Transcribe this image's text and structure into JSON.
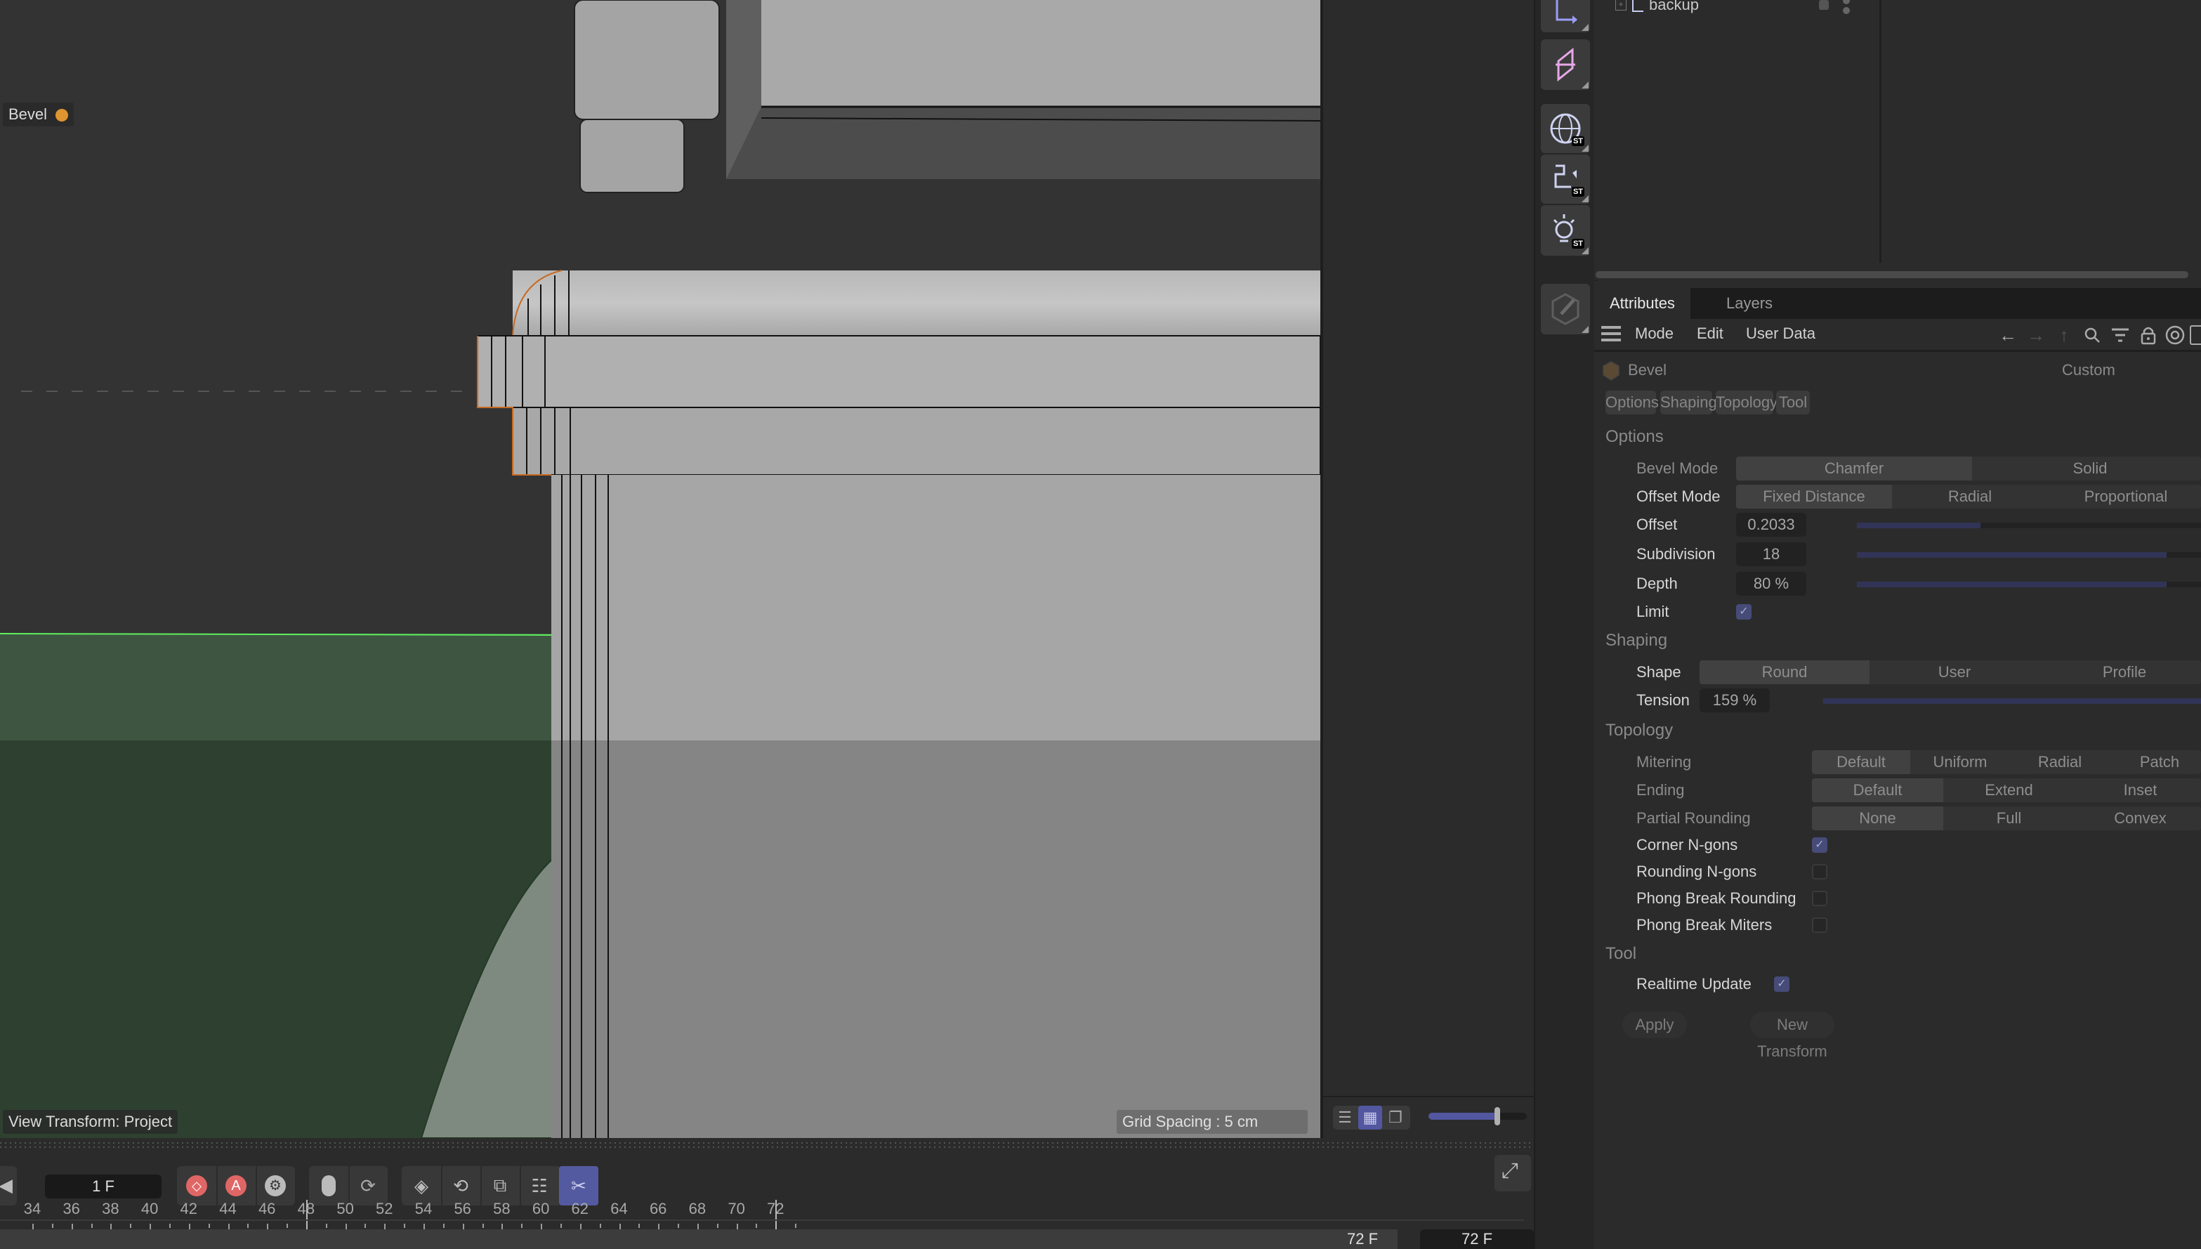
{
  "viewport": {
    "hud_object_label": "Bevel",
    "view_transform_label": "View Transform: Project",
    "grid_spacing_label": "Grid Spacing : 5 cm",
    "view_toggle": {
      "options": [
        "list-view",
        "grid-view",
        "single-view"
      ],
      "selected": "grid-view"
    },
    "zoom_slider_value": 0.7
  },
  "object_manager": {
    "items": [
      {
        "name": "backup",
        "icon": "null-object-icon"
      }
    ]
  },
  "palette": {
    "buttons": [
      "spline-arrow-tool",
      "mirror-tool",
      "sky-st",
      "camera-st",
      "light-st",
      "edit-tool"
    ],
    "badge_text": "ST"
  },
  "attributes": {
    "tabs": [
      {
        "label": "Attributes",
        "active": true
      },
      {
        "label": "Layers",
        "active": false
      }
    ],
    "menu": [
      "Mode",
      "Edit",
      "User Data"
    ],
    "object_name": "Bevel",
    "preset": "Custom",
    "section_tabs": [
      "Options",
      "Shaping",
      "Topology",
      "Tool"
    ],
    "options": {
      "title": "Options",
      "bevel_mode": {
        "label": "Bevel Mode",
        "options": [
          "Chamfer",
          "Solid"
        ],
        "selected": "Chamfer"
      },
      "offset_mode": {
        "label": "Offset Mode",
        "options": [
          "Fixed Distance",
          "Radial",
          "Proportional"
        ],
        "selected": "Fixed Distance"
      },
      "offset": {
        "label": "Offset",
        "value": "0.2033 cm",
        "slider_fraction": 0.36
      },
      "subdivision": {
        "label": "Subdivision",
        "value": "18",
        "slider_fraction": 0.9
      },
      "depth": {
        "label": "Depth",
        "value": "80 %",
        "slider_fraction": 0.9
      },
      "limit": {
        "label": "Limit",
        "checked": true
      }
    },
    "shaping": {
      "title": "Shaping",
      "shape": {
        "label": "Shape",
        "options": [
          "Round",
          "User",
          "Profile"
        ],
        "selected": "Round"
      },
      "tension": {
        "label": "Tension",
        "value": "159 %",
        "slider_fraction": 1.0
      }
    },
    "topology": {
      "title": "Topology",
      "mitering": {
        "label": "Mitering",
        "options": [
          "Default",
          "Uniform",
          "Radial",
          "Patch"
        ],
        "selected": "Default"
      },
      "ending": {
        "label": "Ending",
        "options": [
          "Default",
          "Extend",
          "Inset"
        ],
        "selected": "Default"
      },
      "partial_rounding": {
        "label": "Partial Rounding",
        "options": [
          "None",
          "Full",
          "Convex"
        ],
        "selected": "None"
      },
      "corner_ngons": {
        "label": "Corner N-gons",
        "checked": true
      },
      "rounding_ngons": {
        "label": "Rounding N-gons",
        "checked": false
      },
      "phong_break_rounding": {
        "label": "Phong Break Rounding",
        "checked": false
      },
      "phong_break_miters": {
        "label": "Phong Break Miters",
        "checked": false
      }
    },
    "tool": {
      "title": "Tool",
      "realtime_update": {
        "label": "Realtime Update",
        "checked": true
      },
      "apply_label": "Apply",
      "new_transform_label": "New Transform"
    },
    "check_glyph": "✓"
  },
  "timeline": {
    "current_frame": "1 F",
    "ruler_labels": [
      "34",
      "36",
      "38",
      "40",
      "42",
      "44",
      "46",
      "48",
      "50",
      "52",
      "54",
      "56",
      "58",
      "60",
      "62",
      "64",
      "66",
      "68",
      "70",
      "72"
    ],
    "playhead_frame": 48,
    "end_frame_label": "72 F",
    "max_frame_label": "72 F",
    "colors": {
      "record": "#e06666",
      "active_tool": "#545aa0"
    }
  }
}
